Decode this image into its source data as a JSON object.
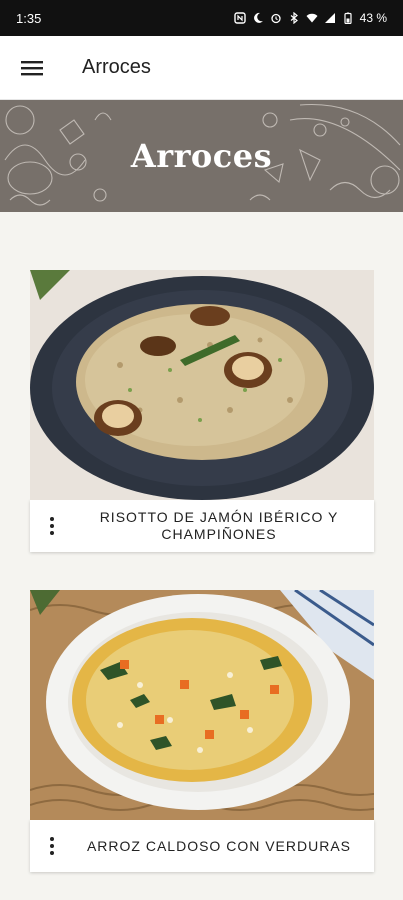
{
  "status_bar": {
    "time": "1:35",
    "battery": "43 %"
  },
  "app_bar": {
    "title": "Arroces",
    "menu_icon": "hamburger-menu-icon"
  },
  "hero": {
    "title": "Arroces"
  },
  "recipes": [
    {
      "title": "RISOTTO DE JAMÓN IBÉRICO Y CHAMPIÑONES",
      "more_icon": "more-vert-icon"
    },
    {
      "title": "ARROZ CALDOSO CON VERDURAS",
      "more_icon": "more-vert-icon"
    }
  ],
  "colors": {
    "status_bar_bg": "#111111",
    "hero_bg": "#77706a",
    "page_bg": "#f5f4f0"
  }
}
